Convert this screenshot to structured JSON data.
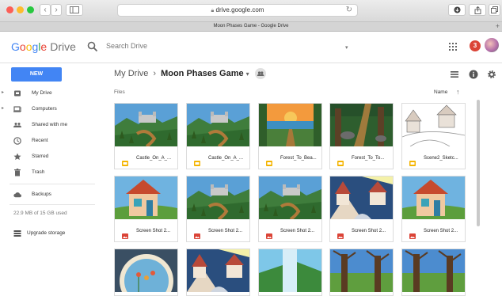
{
  "browser": {
    "url": "drive.google.com",
    "tab_title": "Moon Phases Game - Google Drive",
    "back_glyph": "‹",
    "forward_glyph": "›",
    "reload_glyph": "↻",
    "new_tab_glyph": "+"
  },
  "header": {
    "logo_google": [
      "G",
      "o",
      "o",
      "g",
      "l",
      "e"
    ],
    "logo_drive": "Drive",
    "search_placeholder": "Search Drive",
    "search_caret": "▾",
    "notification_count": "3"
  },
  "toolbar": {
    "new_label": "NEW",
    "breadcrumb_root": "My Drive",
    "breadcrumb_sep": "›",
    "breadcrumb_current": "Moon Phases Game",
    "breadcrumb_caret": "▾"
  },
  "sidebar": {
    "items": [
      {
        "label": "My Drive",
        "icon": "drive-icon",
        "has_arrow": true
      },
      {
        "label": "Computers",
        "icon": "computer-icon",
        "has_arrow": true
      },
      {
        "label": "Shared with me",
        "icon": "people-icon",
        "has_arrow": false
      },
      {
        "label": "Recent",
        "icon": "clock-icon",
        "has_arrow": false
      },
      {
        "label": "Starred",
        "icon": "star-icon",
        "has_arrow": false
      },
      {
        "label": "Trash",
        "icon": "trash-icon",
        "has_arrow": false
      }
    ],
    "backups_label": "Backups",
    "storage_text": "22.9 MB of 15 GB used",
    "upgrade_label": "Upgrade storage",
    "arrow_glyph": "▸"
  },
  "content": {
    "files_label": "Files",
    "sort_label": "Name",
    "sort_arrow": "↑",
    "files": [
      {
        "name": "Castle_On_A_...",
        "type": "slides",
        "scene": "castle"
      },
      {
        "name": "Castle_On_A_...",
        "type": "slides",
        "scene": "castle"
      },
      {
        "name": "Forest_To_Bea...",
        "type": "slides",
        "scene": "sunset"
      },
      {
        "name": "Forest_To_To...",
        "type": "slides",
        "scene": "forest"
      },
      {
        "name": "Scene2_Sketc...",
        "type": "slides",
        "scene": "sketch"
      },
      {
        "name": "Screen Shot 2...",
        "type": "image",
        "scene": "house"
      },
      {
        "name": "Screen Shot 2...",
        "type": "image",
        "scene": "castle"
      },
      {
        "name": "Screen Shot 2...",
        "type": "image",
        "scene": "castle"
      },
      {
        "name": "Screen Shot 2...",
        "type": "image",
        "scene": "village"
      },
      {
        "name": "Screen Shot 2...",
        "type": "image",
        "scene": "house"
      },
      {
        "name": "",
        "type": "image",
        "scene": "window"
      },
      {
        "name": "",
        "type": "image",
        "scene": "village"
      },
      {
        "name": "",
        "type": "image",
        "scene": "waterfall"
      },
      {
        "name": "",
        "type": "image",
        "scene": "trees"
      },
      {
        "name": "",
        "type": "image",
        "scene": "trees"
      }
    ]
  },
  "colors": {
    "accent": "#4285f4",
    "slides_icon": "#f4b400",
    "image_icon": "#db4437",
    "notification": "#db4437"
  }
}
